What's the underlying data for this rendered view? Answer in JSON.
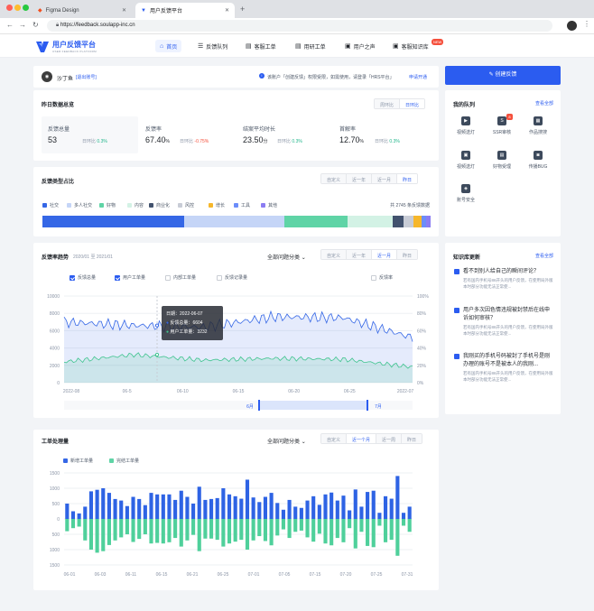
{
  "browser": {
    "tab_inactive": "Figma Design",
    "tab_active": "用户反馈平台",
    "url": "https://feedback.soulapp-inc.cn"
  },
  "app": {
    "logo": "用户反馈平台",
    "logo_sub": "USER FEEDBACK PLATFORM",
    "brand_color": "#2b5cf0",
    "nav": [
      {
        "label": "首页",
        "icon": "home-icon"
      },
      {
        "label": "反馈队列",
        "icon": "queue-icon"
      },
      {
        "label": "客服工单",
        "icon": "service-ticket-icon"
      },
      {
        "label": "用研工单",
        "icon": "research-ticket-icon"
      },
      {
        "label": "用户之声",
        "icon": "voice-icon"
      },
      {
        "label": "客服知识库",
        "icon": "knowledge-icon"
      }
    ],
    "new_badge": "NEW"
  },
  "user": {
    "name": "沙丁鱼",
    "logout": "[退出账号]",
    "notice": "该账户「创建反馈」权限受限，如需使用，请登录「HRS平台」",
    "apply": "申请开通"
  },
  "create_button": "创建反馈",
  "overview": {
    "title": "昨日数据总览",
    "toggle": [
      "周环比",
      "日环比"
    ],
    "metrics": [
      {
        "label": "反馈总量",
        "value": "53",
        "unit": "",
        "cmp_label": "日环比",
        "cmp": "0.3%",
        "trend": "up"
      },
      {
        "label": "反馈率",
        "value": "67.40",
        "unit": "%",
        "cmp_label": "日环比",
        "cmp": "-0.75%",
        "trend": "down"
      },
      {
        "label": "结案平均时长",
        "value": "23.50",
        "unit": "分",
        "cmp_label": "日环比",
        "cmp": "0.3%",
        "trend": "up"
      },
      {
        "label": "首解率",
        "value": "12.70",
        "unit": "%",
        "cmp_label": "日环比",
        "cmp": "0.3%",
        "trend": "up"
      }
    ]
  },
  "types": {
    "title": "反馈类型占比",
    "ranges": [
      "自定义",
      "近一年",
      "近一月",
      "昨日"
    ],
    "total": "共 2745 条反馈数据",
    "items": [
      {
        "name": "社交",
        "color": "#3567e6",
        "share": 0.366
      },
      {
        "name": "多人社交",
        "color": "#c5d5f7",
        "share": 0.258
      },
      {
        "name": "好物",
        "color": "#5fd4a6",
        "share": 0.161
      },
      {
        "name": "内容",
        "color": "#d3f2e5",
        "share": 0.118
      },
      {
        "name": "商业化",
        "color": "#42526e",
        "share": 0.028
      },
      {
        "name": "风控",
        "color": "#c8ccd6",
        "share": 0.024
      },
      {
        "name": "增长",
        "color": "#f6b72b",
        "share": 0.021
      },
      {
        "name": "工具",
        "color": "#6c8dfa",
        "share": 0.012
      },
      {
        "name": "其他",
        "color": "#8b7df2",
        "share": 0.012
      }
    ]
  },
  "trend": {
    "title": "反馈率趋势",
    "date_range": "2020/01 至 2021/01",
    "category": "全部问题分类",
    "ranges": [
      "自定义",
      "近一年",
      "近一月",
      "昨日"
    ],
    "checks": [
      {
        "label": "反馈总量",
        "on": true
      },
      {
        "label": "用户工单量",
        "on": true
      },
      {
        "label": "内部工单量",
        "on": false
      },
      {
        "label": "反馈记录量",
        "on": false
      },
      {
        "label": "反馈率",
        "on": false
      }
    ],
    "y_left": [
      "10000",
      "8000",
      "6000",
      "4000",
      "2000",
      "0"
    ],
    "y_right": [
      "100%",
      "80%",
      "60%",
      "40%",
      "20%",
      "0%"
    ],
    "x_ticks": [
      "2022-08",
      "06-5",
      "06-10",
      "06-15",
      "06-20",
      "06-25",
      "2022-07"
    ],
    "tooltip": {
      "date_label": "日期：",
      "date": "2022-06-07",
      "s1_label": "反馈总量：",
      "s1": "6604",
      "s2_label": "用户工单量：",
      "s2": "3232"
    },
    "brush": {
      "start": "6月",
      "end": "7月"
    }
  },
  "tickets": {
    "title": "工单处理量",
    "category": "全部问题分类",
    "ranges": [
      "自定义",
      "近一个月",
      "近一周",
      "昨日"
    ],
    "legend": [
      "新增工单量",
      "完结工单量"
    ],
    "y_ticks": [
      "1500",
      "1000",
      "500",
      "0",
      "500",
      "1000",
      "1500"
    ],
    "x_ticks": [
      "06-01",
      "06-03",
      "06-11",
      "06-15",
      "06-21",
      "06-25",
      "07-01",
      "07-05",
      "07-15",
      "07-20",
      "07-25",
      "07-31"
    ]
  },
  "queue": {
    "title": "我的队列",
    "more": "查看全部",
    "badge": "8",
    "items": [
      {
        "label": "视频送灯",
        "icon": "video-icon"
      },
      {
        "label": "SSR审核",
        "icon": "ssr-icon"
      },
      {
        "label": "作品搜搜",
        "icon": "works-icon"
      },
      {
        "label": "视频送灯",
        "icon": "video-review-icon"
      },
      {
        "label": "好物受理",
        "icon": "goods-icon"
      },
      {
        "label": "传播BUG",
        "icon": "bug-icon"
      },
      {
        "label": "账号安全",
        "icon": "shield-icon"
      }
    ]
  },
  "kb": {
    "title": "知识库更新",
    "more": "查看全部",
    "items": [
      {
        "title": "看不到别人给自己的瞬间评论？",
        "desc": "若有国内手机号86开头的用户反馈，在使用局外版本时部分功能无法正常使..."
      },
      {
        "title": "用户多次因色情违规被封禁后在线申诉如何审核？",
        "desc": "若有国内手机号86开头的用户反馈，在使用局外版本时部分功能无法正常使..."
      },
      {
        "title": "我刚买的手机号码被封了手机号是刚办理的账号不是被本人的我刚...",
        "desc": "若有国内手机号86开头的用户反馈，在使用局外版本时部分功能无法正常使..."
      }
    ]
  },
  "chart_data": [
    {
      "type": "line",
      "title": "反馈率趋势",
      "x": [
        "2022-06-01",
        "2022-06-07",
        "2022-06-15",
        "2022-06-20",
        "2022-06-25",
        "2022-06-30"
      ],
      "series": [
        {
          "name": "反馈总量",
          "values": [
            7000,
            6604,
            6400,
            7600,
            7500,
            5200
          ]
        },
        {
          "name": "用户工单量",
          "values": [
            2400,
            3232,
            2600,
            2800,
            2700,
            1800
          ]
        }
      ],
      "ylim": [
        0,
        10000
      ],
      "y2lim": [
        0,
        1
      ]
    },
    {
      "type": "bar",
      "title": "工单处理量",
      "series": [
        {
          "name": "新增工单量",
          "values": [
            500,
            250,
            180,
            400,
            900,
            950,
            1000,
            850,
            650,
            600,
            420,
            720,
            650,
            450,
            850,
            800,
            800,
            800,
            620,
            920,
            720,
            500,
            1050,
            620,
            650,
            680,
            1000,
            800,
            740,
            660,
            1280,
            700,
            550,
            720,
            850,
            520,
            300,
            620,
            400,
            360,
            600,
            740,
            460,
            800,
            860,
            600,
            760,
            280,
            960,
            400,
            880,
            920,
            200,
            740,
            660,
            1400,
            200,
            400
          ]
        },
        {
          "name": "完结工单量",
          "values": [
            -400,
            -300,
            -250,
            -700,
            -1000,
            -1100,
            -1050,
            -850,
            -700,
            -600,
            -500,
            -750,
            -650,
            -500,
            -800,
            -780,
            -800,
            -760,
            -620,
            -900,
            -700,
            -520,
            -1050,
            -640,
            -640,
            -680,
            -900,
            -800,
            -740,
            -680,
            -1000,
            -700,
            -560,
            -720,
            -860,
            -540,
            -340,
            -620,
            -420,
            -380,
            -600,
            -740,
            -480,
            -800,
            -860,
            -620,
            -760,
            -300,
            -960,
            -420,
            -880,
            -920,
            -220,
            -760,
            -680,
            -1200,
            -220,
            -420
          ]
        }
      ],
      "ylim": [
        -1500,
        1500
      ]
    }
  ]
}
